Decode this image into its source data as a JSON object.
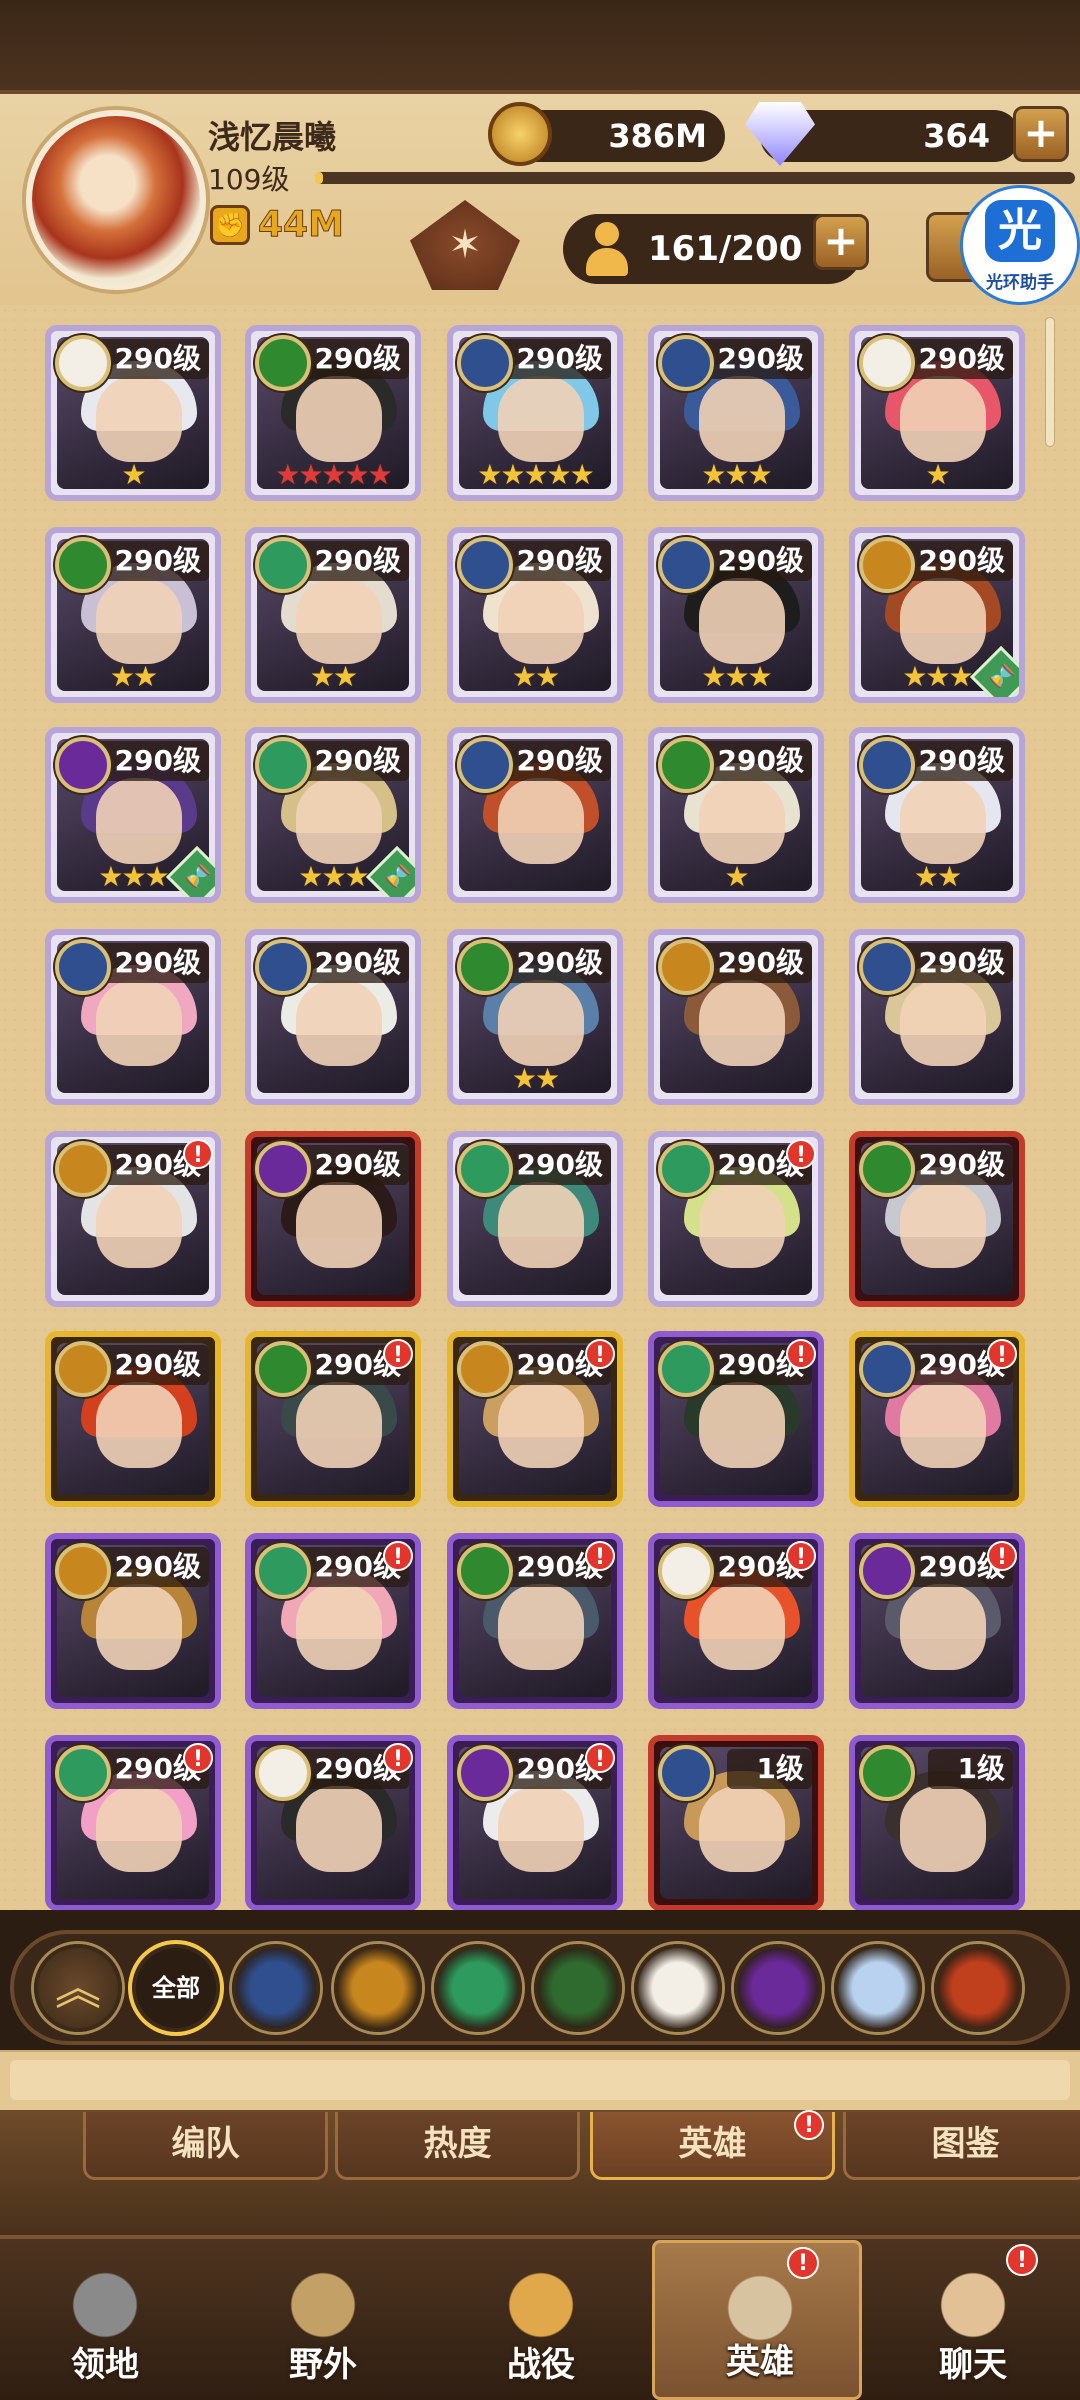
{
  "player": {
    "name": "浅忆晨曦",
    "level": "109级",
    "level_progress": 0.01,
    "power": "44M"
  },
  "resources": {
    "gold": "386M",
    "gems": "364"
  },
  "hero_count": "161/200",
  "assistant": {
    "logo": "光",
    "label": "光环助手"
  },
  "colors": {
    "gold_star": "#f3c43a",
    "red_star": "#e23a3a",
    "notify": "#e2352b",
    "accent": "#f4c84c"
  },
  "heroes": [
    {
      "level": "290级",
      "frame": "silver",
      "faction": "celestial",
      "stars": "★",
      "star_color": "gold",
      "hourglass": false,
      "notify": false,
      "hair": "#e8e8ef"
    },
    {
      "level": "290级",
      "frame": "silver",
      "faction": "graveborn",
      "stars": "★★★★★",
      "star_color": "red",
      "hourglass": false,
      "notify": false,
      "hair": "#2a2a2a"
    },
    {
      "level": "290级",
      "frame": "silver",
      "faction": "lightbearer",
      "stars": "★★★★★",
      "star_color": "gold",
      "hourglass": false,
      "notify": false,
      "hair": "#7fc8e8"
    },
    {
      "level": "290级",
      "frame": "silver",
      "faction": "lightbearer",
      "stars": "★★★",
      "star_color": "gold",
      "hourglass": false,
      "notify": false,
      "hair": "#3a5a9a"
    },
    {
      "level": "290级",
      "frame": "silver",
      "faction": "celestial",
      "stars": "★",
      "star_color": "gold",
      "hourglass": false,
      "notify": false,
      "hair": "#e8566a"
    },
    {
      "level": "290级",
      "frame": "silver",
      "faction": "graveborn",
      "stars": "★★",
      "star_color": "gold",
      "hourglass": false,
      "notify": false,
      "hair": "#c9c0d6"
    },
    {
      "level": "290级",
      "frame": "silver",
      "faction": "wilder",
      "stars": "★★",
      "star_color": "gold",
      "hourglass": false,
      "notify": false,
      "hair": "#e4dccf"
    },
    {
      "level": "290级",
      "frame": "silver",
      "faction": "lightbearer",
      "stars": "★★",
      "star_color": "gold",
      "hourglass": false,
      "notify": false,
      "hair": "#efe2cf"
    },
    {
      "level": "290级",
      "frame": "silver",
      "faction": "lightbearer",
      "stars": "★★★",
      "star_color": "gold",
      "hourglass": false,
      "notify": false,
      "hair": "#1d1d1d"
    },
    {
      "level": "290级",
      "frame": "silver",
      "faction": "mauler",
      "stars": "★★★",
      "star_color": "gold",
      "hourglass": true,
      "notify": false,
      "hair": "#a34a24"
    },
    {
      "level": "290级",
      "frame": "silver",
      "faction": "hypogean",
      "stars": "★★★",
      "star_color": "gold",
      "hourglass": true,
      "notify": false,
      "hair": "#5a3a8a"
    },
    {
      "level": "290级",
      "frame": "silver",
      "faction": "wilder",
      "stars": "★★★",
      "star_color": "gold",
      "hourglass": true,
      "notify": false,
      "hair": "#d6c08a"
    },
    {
      "level": "290级",
      "frame": "silver",
      "faction": "lightbearer",
      "stars": "",
      "star_color": "gold",
      "hourglass": false,
      "notify": false,
      "hair": "#c0502a"
    },
    {
      "level": "290级",
      "frame": "silver",
      "faction": "graveborn",
      "stars": "★",
      "star_color": "gold",
      "hourglass": false,
      "notify": false,
      "hair": "#e8e2d0"
    },
    {
      "level": "290级",
      "frame": "silver",
      "faction": "lightbearer",
      "stars": "★★",
      "star_color": "gold",
      "hourglass": false,
      "notify": false,
      "hair": "#e6e6f0"
    },
    {
      "level": "290级",
      "frame": "silver",
      "faction": "lightbearer",
      "stars": "",
      "star_color": "gold",
      "hourglass": false,
      "notify": false,
      "hair": "#f0a8c0"
    },
    {
      "level": "290级",
      "frame": "silver",
      "faction": "lightbearer",
      "stars": "",
      "star_color": "gold",
      "hourglass": false,
      "notify": false,
      "hair": "#ecece6"
    },
    {
      "level": "290级",
      "frame": "silver",
      "faction": "graveborn",
      "stars": "★★",
      "star_color": "gold",
      "hourglass": false,
      "notify": false,
      "hair": "#5a7fa8"
    },
    {
      "level": "290级",
      "frame": "silver",
      "faction": "mauler",
      "stars": "",
      "star_color": "gold",
      "hourglass": false,
      "notify": false,
      "hair": "#8a5a3a"
    },
    {
      "level": "290级",
      "frame": "silver",
      "faction": "lightbearer",
      "stars": "",
      "star_color": "gold",
      "hourglass": false,
      "notify": false,
      "hair": "#d9c79a"
    },
    {
      "level": "290级",
      "frame": "silver",
      "faction": "mauler",
      "stars": "",
      "star_color": "gold",
      "hourglass": false,
      "notify": true,
      "hair": "#e4e4e4"
    },
    {
      "level": "290级",
      "frame": "red",
      "faction": "hypogean",
      "stars": "",
      "star_color": "gold",
      "hourglass": false,
      "notify": false,
      "hair": "#2a1a1a"
    },
    {
      "level": "290级",
      "frame": "silver",
      "faction": "wilder",
      "stars": "",
      "star_color": "gold",
      "hourglass": false,
      "notify": false,
      "hair": "#3e8a7a"
    },
    {
      "level": "290级",
      "frame": "silver",
      "faction": "wilder",
      "stars": "",
      "star_color": "gold",
      "hourglass": false,
      "notify": true,
      "hair": "#d4e08a"
    },
    {
      "level": "290级",
      "frame": "red",
      "faction": "graveborn",
      "stars": "",
      "star_color": "gold",
      "hourglass": false,
      "notify": false,
      "hair": "#c8c8d0"
    },
    {
      "level": "290级",
      "frame": "gold",
      "faction": "mauler",
      "stars": "",
      "star_color": "gold",
      "hourglass": false,
      "notify": false,
      "hair": "#d2401e"
    },
    {
      "level": "290级",
      "frame": "gold",
      "faction": "graveborn",
      "stars": "",
      "star_color": "gold",
      "hourglass": false,
      "notify": true,
      "hair": "#3a4a4a"
    },
    {
      "level": "290级",
      "frame": "gold",
      "faction": "mauler",
      "stars": "",
      "star_color": "gold",
      "hourglass": false,
      "notify": true,
      "hair": "#c9a060"
    },
    {
      "level": "290级",
      "frame": "purple",
      "faction": "wilder",
      "stars": "",
      "star_color": "gold",
      "hourglass": false,
      "notify": true,
      "hair": "#2a3a2a"
    },
    {
      "level": "290级",
      "frame": "gold",
      "faction": "lightbearer",
      "stars": "",
      "star_color": "gold",
      "hourglass": false,
      "notify": true,
      "hair": "#e07aa0"
    },
    {
      "level": "290级",
      "frame": "purple",
      "faction": "mauler",
      "stars": "",
      "star_color": "gold",
      "hourglass": false,
      "notify": false,
      "hair": "#b8843a"
    },
    {
      "level": "290级",
      "frame": "purple",
      "faction": "wilder",
      "stars": "",
      "star_color": "gold",
      "hourglass": false,
      "notify": true,
      "hair": "#f0a8b8"
    },
    {
      "level": "290级",
      "frame": "purple",
      "faction": "graveborn",
      "stars": "",
      "star_color": "gold",
      "hourglass": false,
      "notify": true,
      "hair": "#4a5a6a"
    },
    {
      "level": "290级",
      "frame": "purple",
      "faction": "celestial",
      "stars": "",
      "star_color": "gold",
      "hourglass": false,
      "notify": true,
      "hair": "#e8522a"
    },
    {
      "level": "290级",
      "frame": "purple",
      "faction": "hypogean",
      "stars": "",
      "star_color": "gold",
      "hourglass": false,
      "notify": true,
      "hair": "#5a5a6a"
    },
    {
      "level": "290级",
      "frame": "purple",
      "faction": "wilder",
      "stars": "",
      "star_color": "gold",
      "hourglass": false,
      "notify": true,
      "hair": "#f2a0c8"
    },
    {
      "level": "290级",
      "frame": "purple",
      "faction": "celestial",
      "stars": "",
      "star_color": "gold",
      "hourglass": false,
      "notify": true,
      "hair": "#2a2a2a"
    },
    {
      "level": "290级",
      "frame": "purple",
      "faction": "hypogean",
      "stars": "",
      "star_color": "gold",
      "hourglass": false,
      "notify": true,
      "hair": "#ececec"
    },
    {
      "level": "1级",
      "frame": "red",
      "faction": "lightbearer",
      "stars": "",
      "star_color": "gold",
      "hourglass": false,
      "notify": false,
      "hair": "#c89a5a"
    },
    {
      "level": "1级",
      "frame": "purple",
      "faction": "graveborn",
      "stars": "",
      "star_color": "gold",
      "hourglass": false,
      "notify": false,
      "hair": "#3a3030"
    }
  ],
  "faction_colors": {
    "celestial": "#f3efe6",
    "graveborn": "#2f8a2f",
    "lightbearer": "#2f4f8f",
    "wilder": "#2e9a5e",
    "mauler": "#c8861e",
    "hypogean": "#6a2a9a",
    "dimensional": "#b9d2f0",
    "draconis": "#c0401e"
  },
  "filters": [
    {
      "id": "up",
      "icon": "chevron-up-icon",
      "label": "︽"
    },
    {
      "id": "all",
      "icon": "",
      "label": "全部"
    },
    {
      "id": "lightbearer",
      "icon": "star-compass-icon",
      "color": "#2f4f8f"
    },
    {
      "id": "mauler",
      "icon": "mauler-icon",
      "color": "#c8861e"
    },
    {
      "id": "wilder",
      "icon": "leaf-icon",
      "color": "#2e9a5e"
    },
    {
      "id": "graveborn",
      "icon": "eye-icon",
      "color": "#2f6a2f"
    },
    {
      "id": "celestial",
      "icon": "celestial-star-icon",
      "color": "#f3efe6"
    },
    {
      "id": "hypogean",
      "icon": "hypogean-icon",
      "color": "#6a2a9a"
    },
    {
      "id": "dimensional",
      "icon": "dimensional-icon",
      "color": "#b9d2f0"
    },
    {
      "id": "draconis",
      "icon": "flame-icon",
      "color": "#c0401e"
    }
  ],
  "sub_tabs": [
    {
      "label": "编队",
      "active": false,
      "notify": false
    },
    {
      "label": "热度",
      "active": false,
      "notify": false
    },
    {
      "label": "英雄",
      "active": true,
      "notify": true
    },
    {
      "label": "图鉴",
      "active": false,
      "notify": false
    }
  ],
  "nav": [
    {
      "label": "领地",
      "icon": "castle-icon",
      "active": false,
      "notify": false
    },
    {
      "label": "野外",
      "icon": "map-scroll-icon",
      "active": false,
      "notify": false
    },
    {
      "label": "战役",
      "icon": "sword-crest-icon",
      "active": false,
      "notify": false
    },
    {
      "label": "英雄",
      "icon": "hero-helmet-icon",
      "active": true,
      "notify": true
    },
    {
      "label": "聊天",
      "icon": "chat-bubble-icon",
      "active": false,
      "notify": true
    }
  ],
  "notify_mark": "!",
  "plus_label": "+",
  "hourglass_glyph": "⌛",
  "class_glyph": "✶"
}
